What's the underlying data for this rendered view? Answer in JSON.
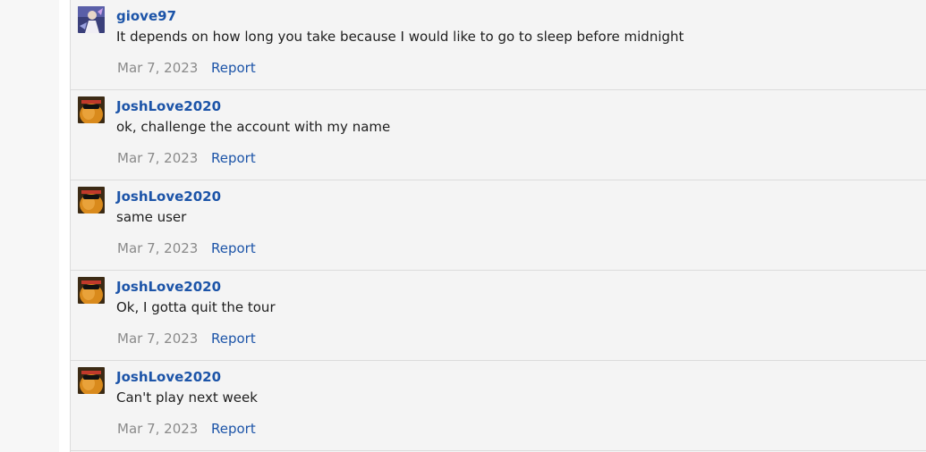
{
  "comments": [
    {
      "username": "giove97",
      "avatar": "giove97-avatar",
      "text": "It depends on how long you take because I would like to go to sleep before midnight",
      "date": "Mar 7, 2023",
      "report_label": "Report"
    },
    {
      "username": "JoshLove2020",
      "avatar": "joshlove2020-avatar",
      "text": "ok, challenge the account with my name",
      "date": "Mar 7, 2023",
      "report_label": "Report"
    },
    {
      "username": "JoshLove2020",
      "avatar": "joshlove2020-avatar",
      "text": "same user",
      "date": "Mar 7, 2023",
      "report_label": "Report"
    },
    {
      "username": "JoshLove2020",
      "avatar": "joshlove2020-avatar",
      "text": "Ok, I gotta quit the tour",
      "date": "Mar 7, 2023",
      "report_label": "Report"
    },
    {
      "username": "JoshLove2020",
      "avatar": "joshlove2020-avatar",
      "text": "Can't play next week",
      "date": "Mar 7, 2023",
      "report_label": "Report"
    }
  ],
  "colors": {
    "link": "#1c54a8",
    "date": "#8a8a8a",
    "text": "#1e1e1e",
    "thread_bg": "#f4f4f4"
  }
}
